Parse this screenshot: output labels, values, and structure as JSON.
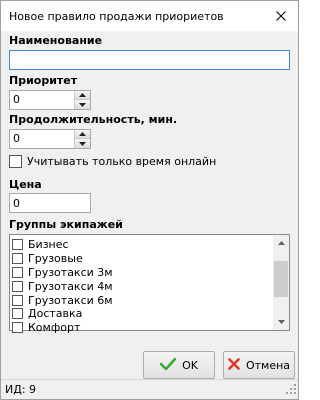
{
  "window": {
    "title": "Новое правило продажи приориетов",
    "close_icon": "close-icon"
  },
  "form": {
    "name_label": "Наименование",
    "name_value": "",
    "priority_label": "Приоритет",
    "priority_value": "0",
    "duration_label": "Продолжительность, мин.",
    "duration_value": "0",
    "online_only_label": "Учитывать только время онлайн",
    "online_only_checked": false,
    "price_label": "Цена",
    "price_value": "0",
    "crew_groups_label": "Группы экипажей",
    "crew_groups": [
      {
        "label": "Бизнес",
        "checked": false
      },
      {
        "label": "Грузовые",
        "checked": false
      },
      {
        "label": "Грузотакси 3м",
        "checked": false
      },
      {
        "label": "Грузотакси 4м",
        "checked": false
      },
      {
        "label": "Грузотакси 6м",
        "checked": false
      },
      {
        "label": "Доставка",
        "checked": false
      },
      {
        "label": "Комфорт",
        "checked": false
      }
    ]
  },
  "buttons": {
    "ok_label": "OK",
    "cancel_label": "Отмена",
    "ok_icon": "checkmark-icon",
    "cancel_icon": "cross-icon"
  },
  "statusbar": {
    "id_text": "ИД: 9"
  },
  "colors": {
    "focus_border": "#3c8dd6",
    "ok_green": "#3aa834",
    "cancel_red": "#d93a2b"
  }
}
